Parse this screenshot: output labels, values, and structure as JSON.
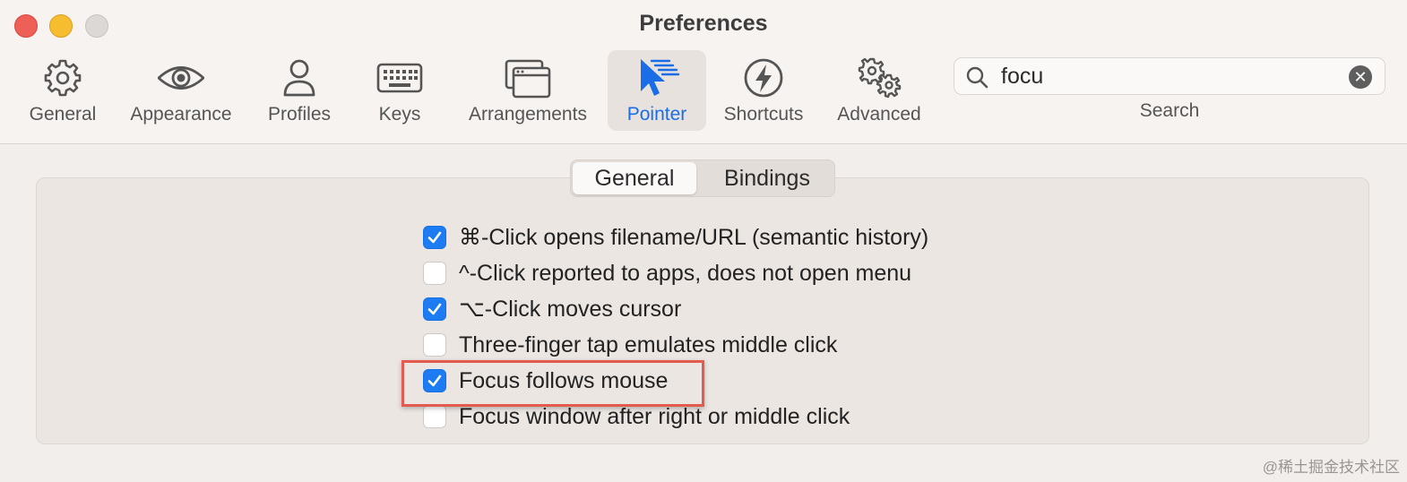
{
  "window": {
    "title": "Preferences"
  },
  "toolbar": {
    "items": [
      {
        "label": "General",
        "icon": "gear-icon"
      },
      {
        "label": "Appearance",
        "icon": "eye-icon"
      },
      {
        "label": "Profiles",
        "icon": "person-icon"
      },
      {
        "label": "Keys",
        "icon": "keyboard-icon"
      },
      {
        "label": "Arrangements",
        "icon": "windows-icon"
      },
      {
        "label": "Pointer",
        "icon": "pointer-icon",
        "selected": true
      },
      {
        "label": "Shortcuts",
        "icon": "bolt-icon"
      },
      {
        "label": "Advanced",
        "icon": "gears-icon"
      }
    ]
  },
  "search": {
    "value": "focu",
    "label": "Search"
  },
  "tabs": {
    "general": "General",
    "bindings": "Bindings",
    "selected": "General"
  },
  "options": [
    {
      "label": "⌘-Click opens filename/URL (semantic history)",
      "checked": true
    },
    {
      "label": "^-Click reported to apps, does not open menu",
      "checked": false
    },
    {
      "label": "⌥-Click moves cursor",
      "checked": true
    },
    {
      "label": "Three-finger tap emulates middle click",
      "checked": false
    },
    {
      "label": "Focus follows mouse",
      "checked": true
    },
    {
      "label": "Focus window after right or middle click",
      "checked": false
    }
  ],
  "watermark": "@稀土掘金技术社区",
  "colors": {
    "accent": "#1d7cf2",
    "highlight": "#e25b4e"
  }
}
